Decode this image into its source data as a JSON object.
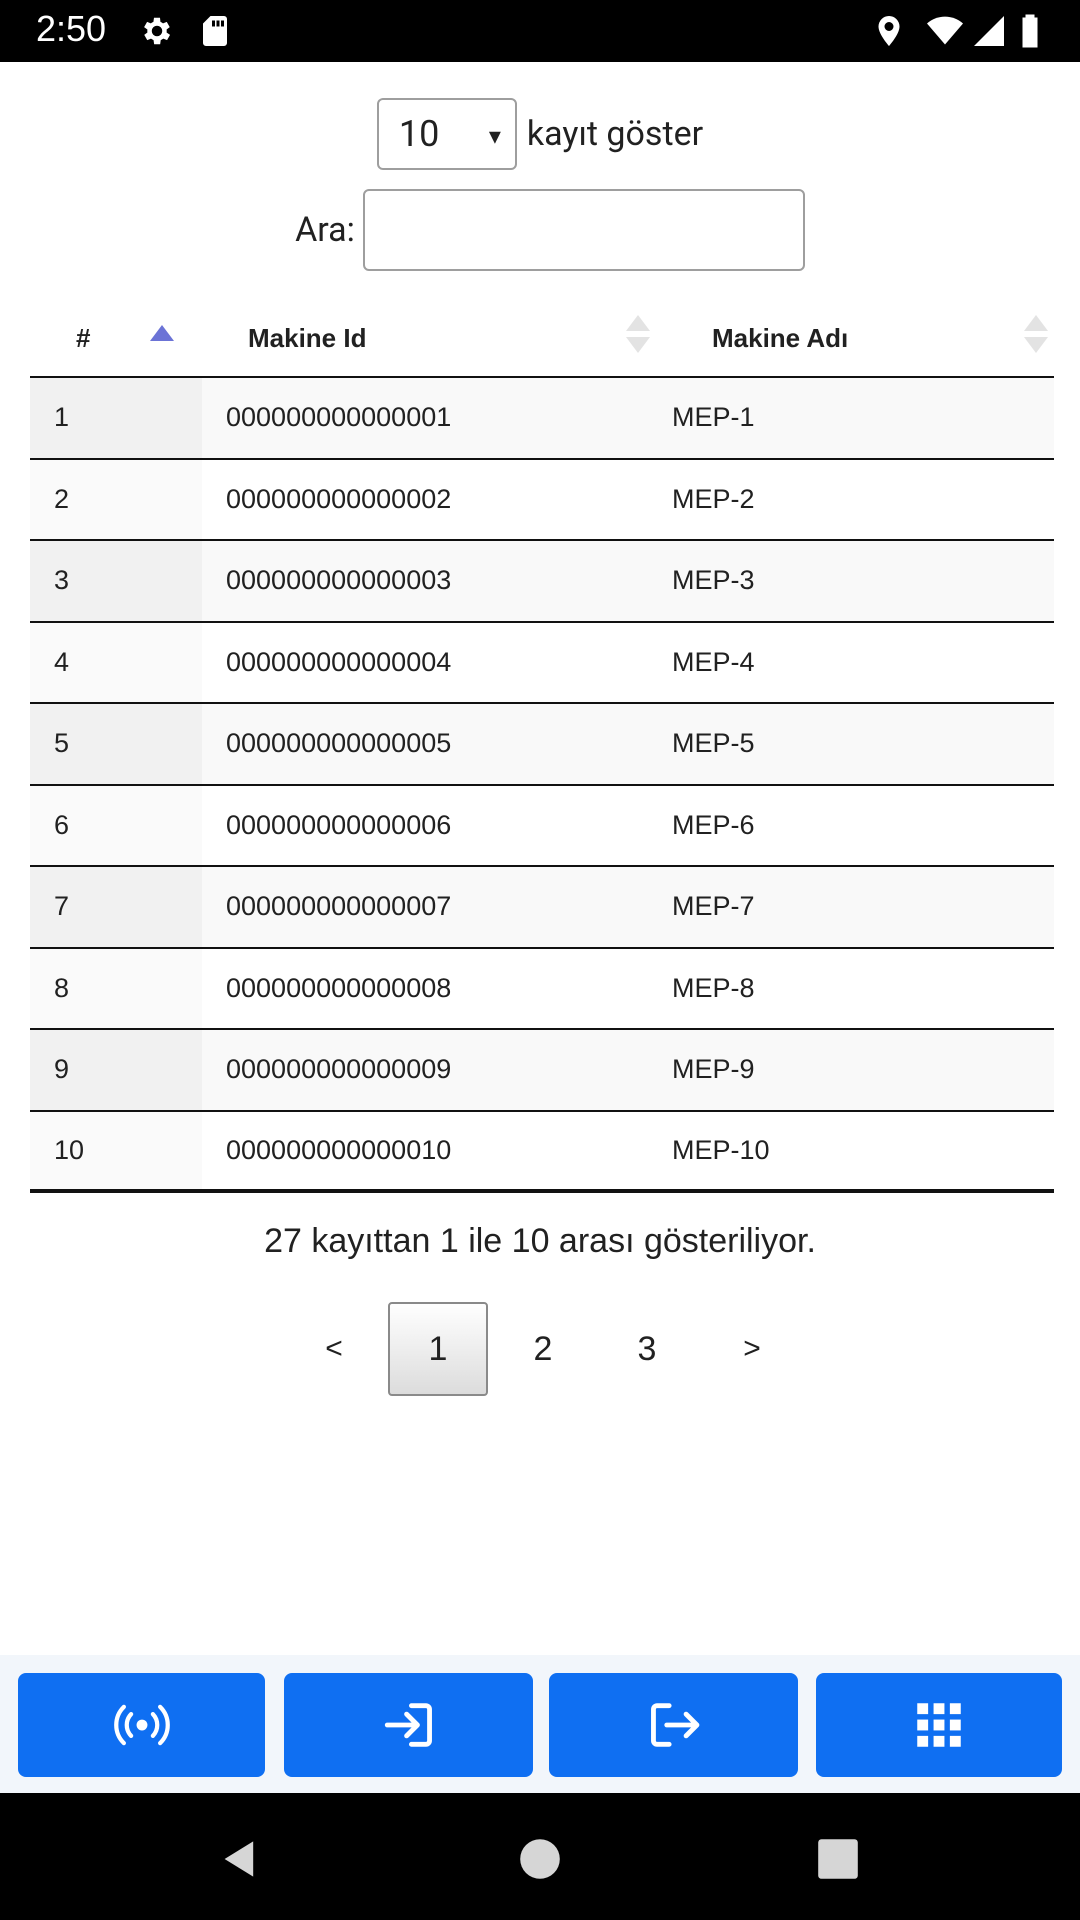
{
  "status_bar": {
    "time": "2:50",
    "left_icons": [
      "gear-icon",
      "sd-card-icon"
    ],
    "right_icons": [
      "location-icon",
      "wifi-icon",
      "signal-icon",
      "battery-icon"
    ]
  },
  "length_control": {
    "selected": "10",
    "caret": "▾",
    "label": "kayıt göster"
  },
  "search": {
    "label": "Ara:",
    "value": "",
    "placeholder": ""
  },
  "table": {
    "columns": [
      "#",
      "Makine Id",
      "Makine Adı"
    ],
    "sorted_column": "#",
    "sort_direction": "ascending",
    "rows": [
      {
        "num": "1",
        "id": "000000000000001",
        "name": "MEP-1"
      },
      {
        "num": "2",
        "id": "000000000000002",
        "name": "MEP-2"
      },
      {
        "num": "3",
        "id": "000000000000003",
        "name": "MEP-3"
      },
      {
        "num": "4",
        "id": "000000000000004",
        "name": "MEP-4"
      },
      {
        "num": "5",
        "id": "000000000000005",
        "name": "MEP-5"
      },
      {
        "num": "6",
        "id": "000000000000006",
        "name": "MEP-6"
      },
      {
        "num": "7",
        "id": "000000000000007",
        "name": "MEP-7"
      },
      {
        "num": "8",
        "id": "000000000000008",
        "name": "MEP-8"
      },
      {
        "num": "9",
        "id": "000000000000009",
        "name": "MEP-9"
      },
      {
        "num": "10",
        "id": "000000000000010",
        "name": "MEP-10"
      }
    ]
  },
  "info_text": "27 kayıttan 1 ile 10 arası gösteriliyor.",
  "pagination": {
    "prev": "<",
    "current": "1",
    "page2": "2",
    "page3": "3",
    "next": ">"
  },
  "toolbar": {
    "buttons": [
      "broadcast-icon",
      "login-icon",
      "logout-icon",
      "grid-icon"
    ],
    "color": "#0f6ff2"
  },
  "nav_bar": {
    "buttons": [
      "back-icon",
      "home-icon",
      "recents-icon"
    ]
  },
  "colors": {
    "sort_active": "#6b73d6",
    "sort_inactive": "#e3e3e3",
    "toolbar_bg": "#f2f6fb"
  }
}
